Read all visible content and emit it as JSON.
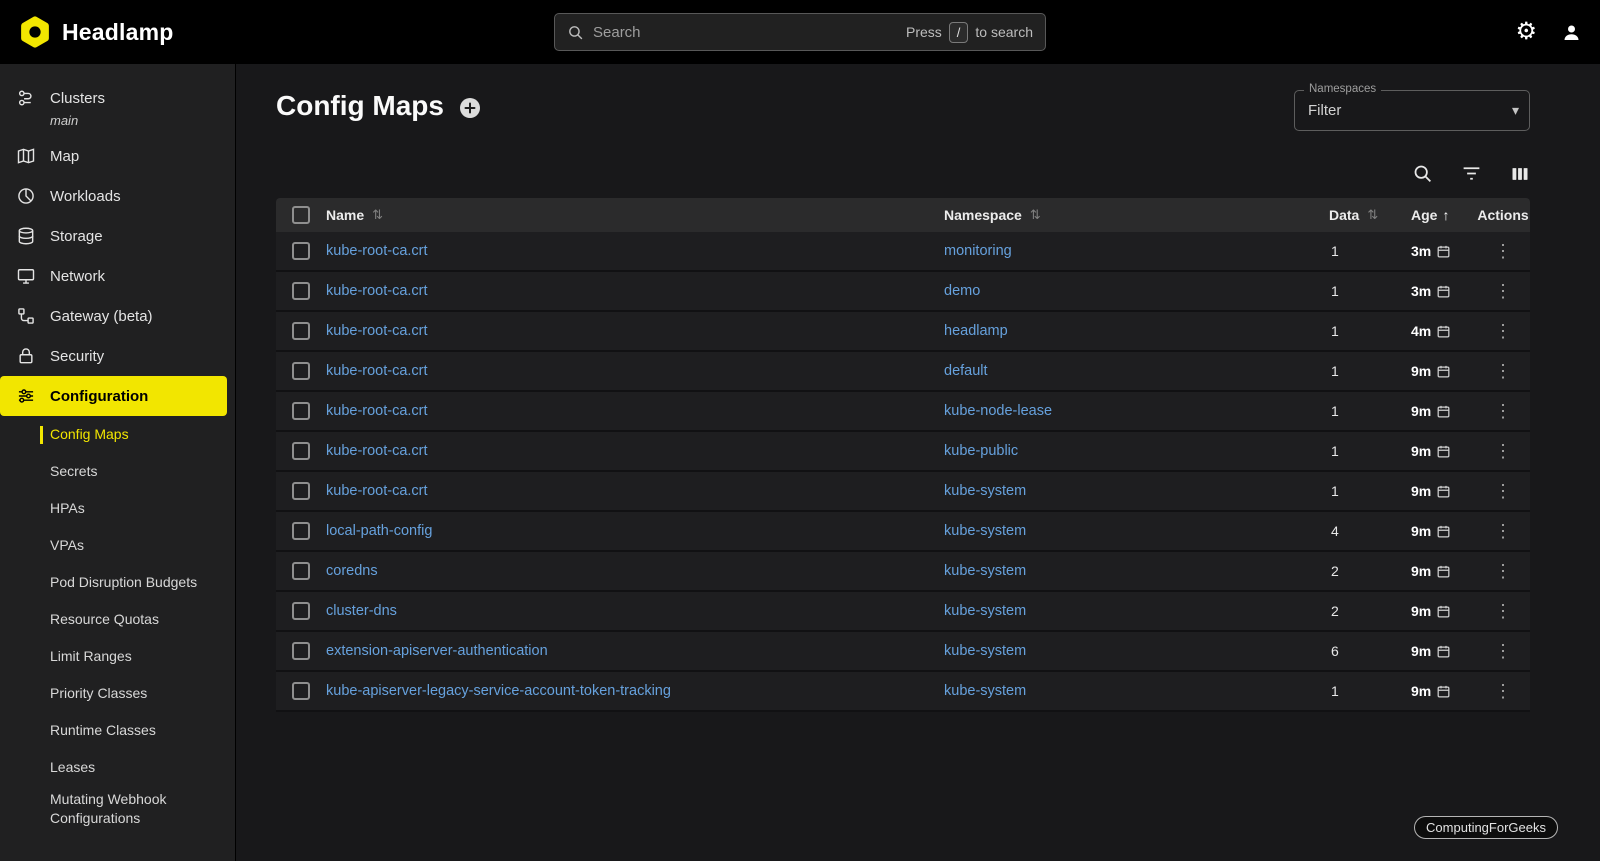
{
  "colors": {
    "accent_yellow": "#f2e600",
    "link_blue": "#66a1dd",
    "topbar_bg": "#000000"
  },
  "topbar": {
    "brand": "Headlamp",
    "search_placeholder": "Search",
    "press": "Press",
    "slash_key": "/",
    "to_search": "to search"
  },
  "sidebar": {
    "items": [
      {
        "label": "Clusters",
        "subtitle": "main"
      },
      {
        "label": "Map"
      },
      {
        "label": "Workloads"
      },
      {
        "label": "Storage"
      },
      {
        "label": "Network"
      },
      {
        "label": "Gateway (beta)"
      },
      {
        "label": "Security"
      },
      {
        "label": "Configuration"
      }
    ],
    "config_children": [
      "Config Maps",
      "Secrets",
      "HPAs",
      "VPAs",
      "Pod Disruption Budgets",
      "Resource Quotas",
      "Limit Ranges",
      "Priority Classes",
      "Runtime Classes",
      "Leases",
      "Mutating Webhook Configurations"
    ]
  },
  "content": {
    "title": "Config Maps",
    "namespaces_label": "Namespaces",
    "namespaces_value": "Filter",
    "table": {
      "headers": {
        "name": "Name",
        "namespace": "Namespace",
        "data": "Data",
        "age": "Age",
        "actions": "Actions"
      },
      "rows": [
        {
          "name": "kube-root-ca.crt",
          "namespace": "monitoring",
          "data": "1",
          "age": "3m"
        },
        {
          "name": "kube-root-ca.crt",
          "namespace": "demo",
          "data": "1",
          "age": "3m"
        },
        {
          "name": "kube-root-ca.crt",
          "namespace": "headlamp",
          "data": "1",
          "age": "4m"
        },
        {
          "name": "kube-root-ca.crt",
          "namespace": "default",
          "data": "1",
          "age": "9m"
        },
        {
          "name": "kube-root-ca.crt",
          "namespace": "kube-node-lease",
          "data": "1",
          "age": "9m"
        },
        {
          "name": "kube-root-ca.crt",
          "namespace": "kube-public",
          "data": "1",
          "age": "9m"
        },
        {
          "name": "kube-root-ca.crt",
          "namespace": "kube-system",
          "data": "1",
          "age": "9m"
        },
        {
          "name": "local-path-config",
          "namespace": "kube-system",
          "data": "4",
          "age": "9m"
        },
        {
          "name": "coredns",
          "namespace": "kube-system",
          "data": "2",
          "age": "9m"
        },
        {
          "name": "cluster-dns",
          "namespace": "kube-system",
          "data": "2",
          "age": "9m"
        },
        {
          "name": "extension-apiserver-authentication",
          "namespace": "kube-system",
          "data": "6",
          "age": "9m"
        },
        {
          "name": "kube-apiserver-legacy-service-account-token-tracking",
          "namespace": "kube-system",
          "data": "1",
          "age": "9m"
        }
      ]
    }
  },
  "icons": {
    "sort": "⇅",
    "sort_asc": "↑",
    "more_vertical": "⋮",
    "gear": "⚙",
    "caret": "▾"
  },
  "watermark": "ComputingForGeeks"
}
